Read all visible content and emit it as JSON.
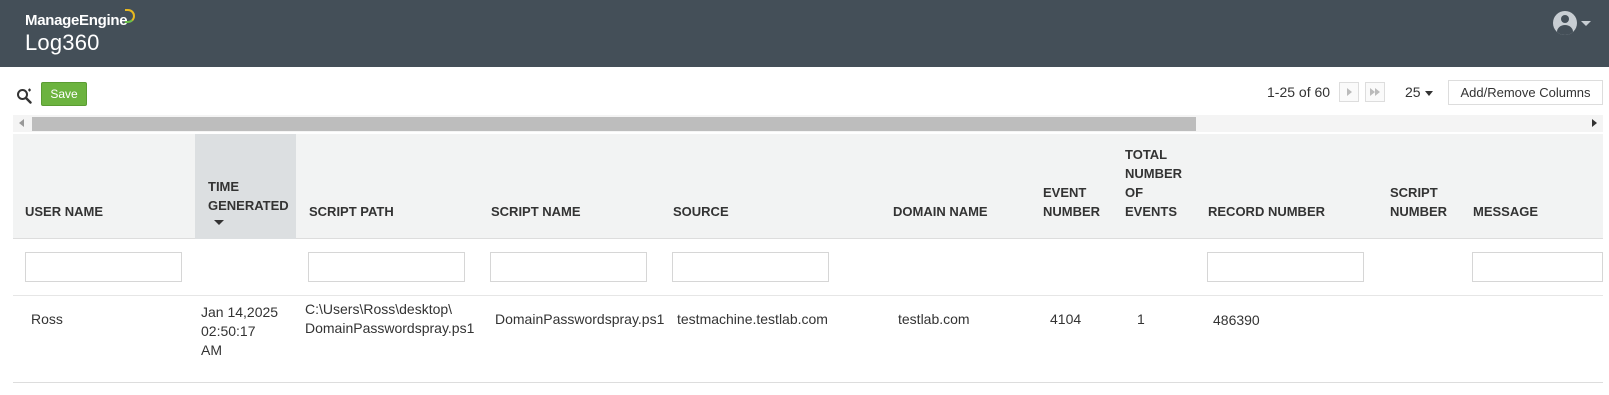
{
  "header": {
    "brand_top": "ManageEngine",
    "product": "Log360"
  },
  "toolbar": {
    "save_label": "Save",
    "pagination": "1-25 of 60",
    "per_page": "25",
    "columns_button": "Add/Remove Columns"
  },
  "table": {
    "columns": [
      {
        "lines": [
          "USER NAME"
        ]
      },
      {
        "lines": [
          "TIME",
          "GENERATED"
        ],
        "sorted": true
      },
      {
        "lines": [
          "SCRIPT PATH"
        ]
      },
      {
        "lines": [
          "SCRIPT NAME"
        ]
      },
      {
        "lines": [
          "SOURCE"
        ]
      },
      {
        "lines": [
          "DOMAIN NAME"
        ]
      },
      {
        "lines": [
          "EVENT",
          "NUMBER"
        ]
      },
      {
        "lines": [
          "TOTAL",
          "NUMBER",
          "OF",
          "EVENTS"
        ]
      },
      {
        "lines": [
          "RECORD NUMBER"
        ]
      },
      {
        "lines": [
          "SCRIPT",
          "NUMBER"
        ]
      },
      {
        "lines": [
          "MESSAGE"
        ]
      }
    ],
    "filters": {
      "user_name": "",
      "script_path": "",
      "script_name": "",
      "source": "",
      "record_number": "",
      "message": ""
    },
    "rows": [
      {
        "user_name": "Ross",
        "time_generated": [
          "Jan 14,2025",
          "02:50:17",
          "AM"
        ],
        "script_path": [
          "C:\\Users\\Ross\\desktop\\",
          "DomainPasswordspray.ps1"
        ],
        "script_name": "DomainPasswordspray.ps1",
        "source": "testmachine.testlab.com",
        "domain_name": "testlab.com",
        "event_number": "4104",
        "total_events": "1",
        "record_number": "486390",
        "script_number": "",
        "message": ""
      }
    ]
  }
}
